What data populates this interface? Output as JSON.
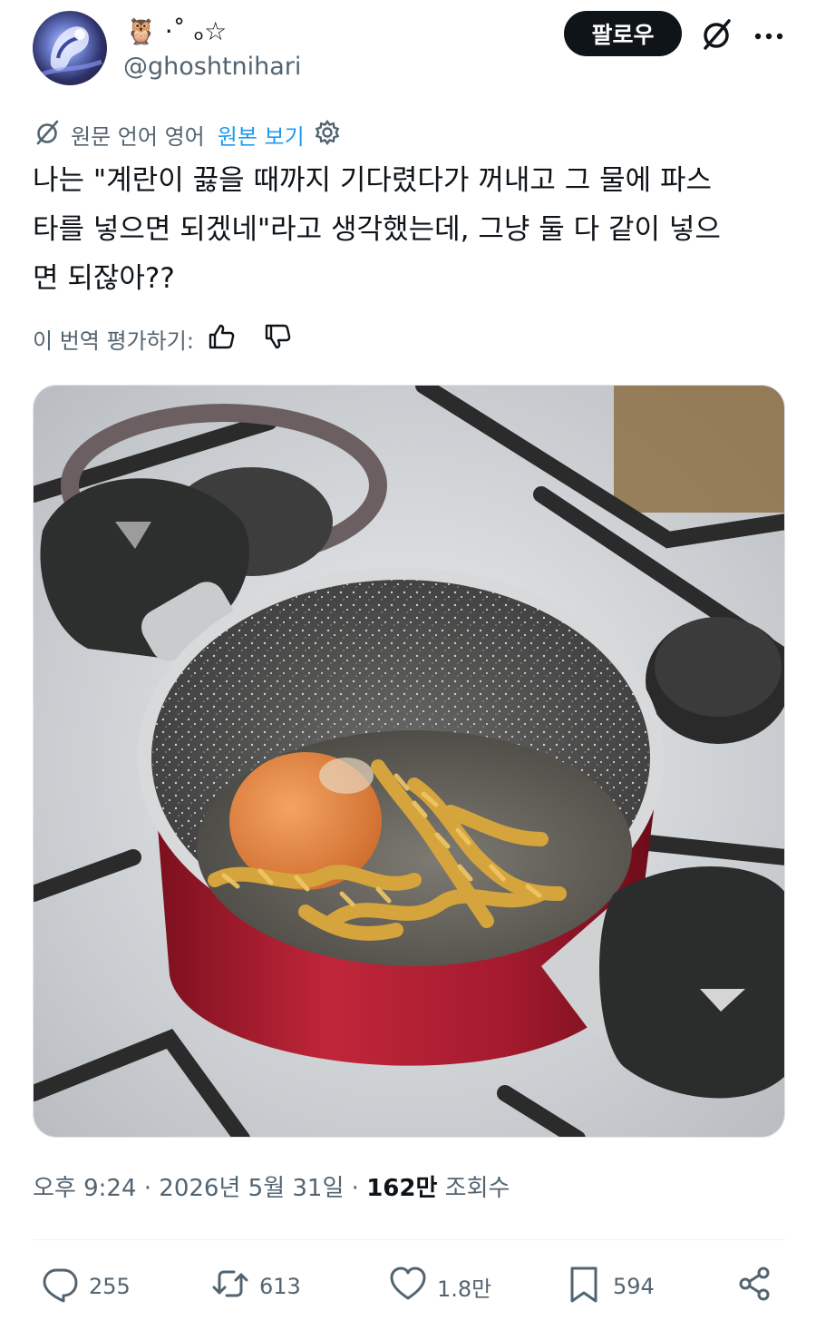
{
  "user": {
    "display_name": "🦉 ·˚ ₒ☆",
    "handle": "@ghoshtnihari",
    "follow_label": "팔로우"
  },
  "translation": {
    "source_language_label": "원문 언어 영어",
    "show_original_label": "원본 보기"
  },
  "tweet": {
    "text": "나는 \"계란이 끓을 때까지 기다렸다가 꺼내고 그 물에 파스\n타를 넣으면 되겠네\"라고 생각했는데, 그냥 둘 다 같이 넣으\n면 되잖아??"
  },
  "rating": {
    "label": "이 번역 평가하기:"
  },
  "media": {
    "description_icon": "photo"
  },
  "meta": {
    "time": "오후 9:24",
    "separator1": " · ",
    "date": "2026년 5월 31일",
    "separator2": " · ",
    "views_count": "162만",
    "views_label": " 조회수"
  },
  "actions": {
    "replies": "255",
    "reposts": "613",
    "likes": "1.8만",
    "bookmarks": "594"
  },
  "colors": {
    "text": "#0f1419",
    "secondary": "#536471",
    "link": "#1d9bf0",
    "pot_red": "#b01c30"
  },
  "icons": [
    "grok-icon",
    "more-icon",
    "settings-gear-icon",
    "thumbs-up-icon",
    "thumbs-down-icon",
    "reply-icon",
    "repost-icon",
    "like-icon",
    "bookmark-icon",
    "share-icon"
  ]
}
